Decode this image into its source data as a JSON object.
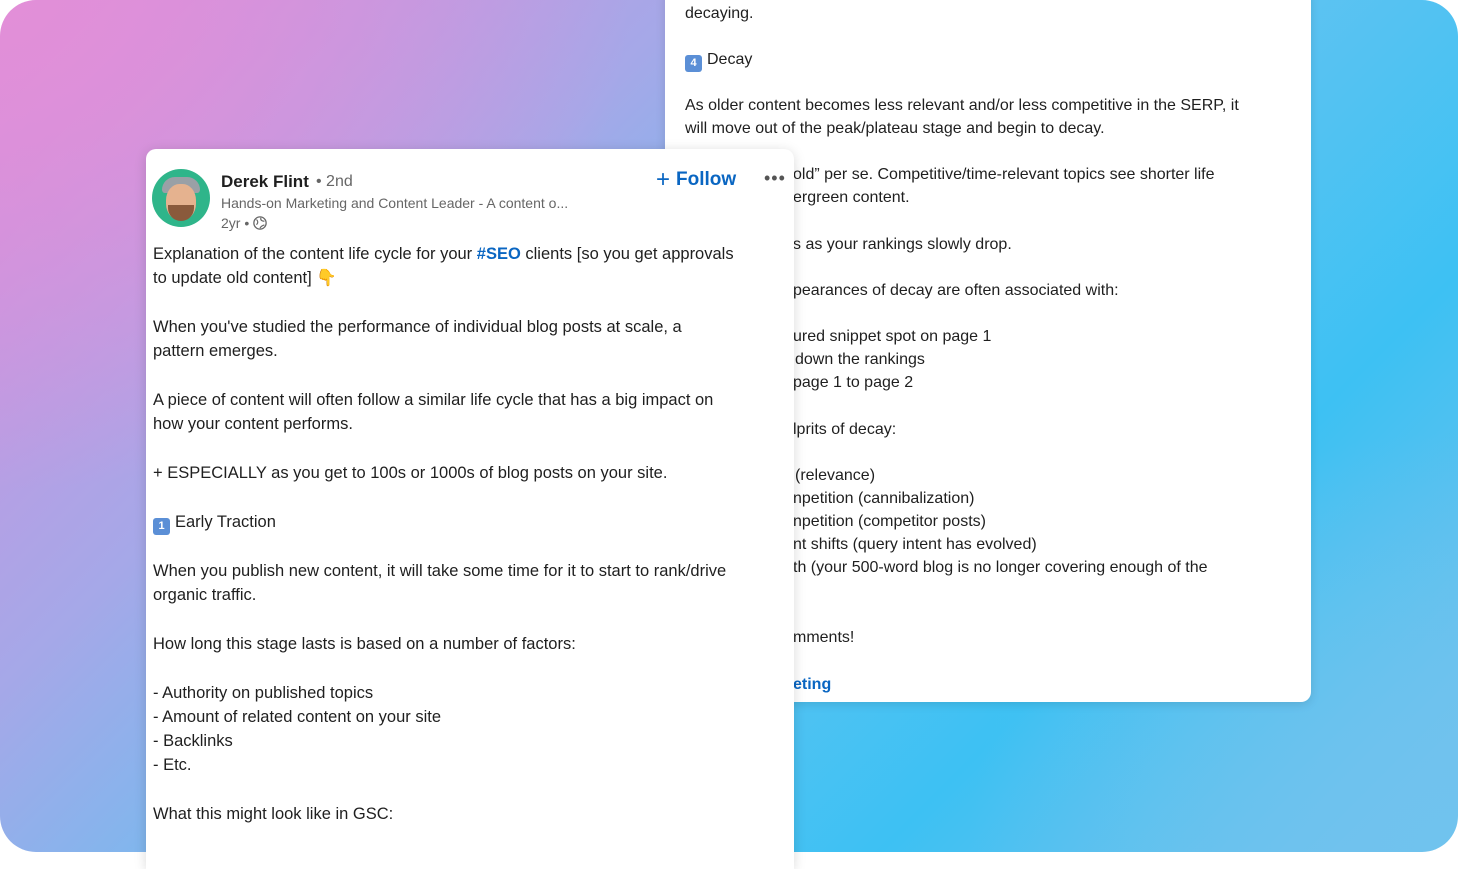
{
  "back_post": {
    "lines": [
      "decaying.",
      "Decay",
      "As older content becomes less relevant and/or less competitive in the SERP, it",
      "will move out of the peak/plateau stage and begin to decay.",
      "old” per se. Competitive/time-relevant topics see shorter life",
      "ergreen content.",
      "s as your rankings slowly drop.",
      "pearances of decay are often associated with:",
      "ured snippet spot on page 1",
      "down the rankings",
      "page 1 to page 2",
      "lprits of decay:",
      "(relevance)",
      "npetition (cannibalization)",
      "npetition (competitor posts)",
      "nt shifts (query intent has evolved)",
      "th (your 500-word blog is no longer covering enough of the",
      "mments!",
      "eting"
    ],
    "decay_emoji": "4"
  },
  "front_post": {
    "author": {
      "name": "Derek Flint",
      "degree": "• 2nd",
      "headline": "Hands-on Marketing and Content Leader - A content o...",
      "time": "2yr •"
    },
    "follow_label": "Follow",
    "more_label": "•••",
    "intro_pre": "Explanation of the content life cycle for your ",
    "hashtag": "#SEO",
    "intro_post": " clients [so you get approvals",
    "intro_line2": "to update old content] 👇",
    "para1_line1": "When you've studied the performance of individual blog posts at scale, a",
    "para1_line2": "pattern emerges.",
    "para2_line1": "A piece of content will often follow a similar life cycle that has a big impact on",
    "para2_line2": "how your content performs.",
    "para3": "+ ESPECIALLY as you get to 100s or 1000s of blog posts on your site.",
    "stage1_emoji": "1",
    "stage1_title": "Early Traction",
    "para4_line1": "When you publish new content, it will take some time for it to start to rank/drive",
    "para4_line2": "organic traffic.",
    "para5": "How long this stage lasts is based on a number of factors:",
    "factors": [
      "- Authority on published topics",
      "- Amount of related content on your site",
      "- Backlinks",
      "- Etc."
    ],
    "para6": "What this might look like in GSC:"
  },
  "colors": {
    "link": "#0a66c2",
    "text": "#1f1f1f",
    "muted": "#666666"
  }
}
